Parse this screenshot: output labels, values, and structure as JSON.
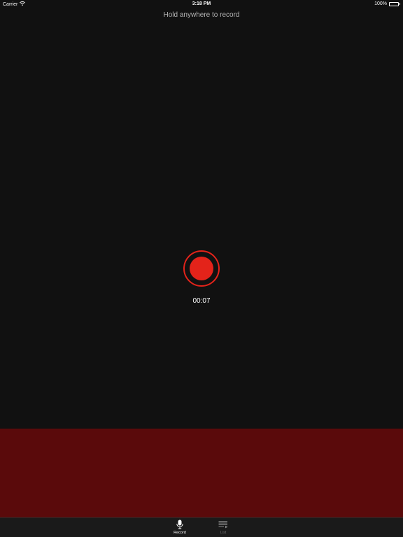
{
  "status_bar": {
    "carrier": "Carrier",
    "time": "3:18 PM",
    "battery": "100%"
  },
  "hint": "Hold anywhere to record",
  "recorder": {
    "timer": "00:07",
    "accent_color": "#e3231a",
    "level_panel_color": "#5a0a0b"
  },
  "tab_bar": {
    "tabs": [
      {
        "label": "Record",
        "icon": "microphone-icon",
        "selected": true
      },
      {
        "label": "List",
        "icon": "playlist-icon",
        "selected": false
      }
    ]
  }
}
